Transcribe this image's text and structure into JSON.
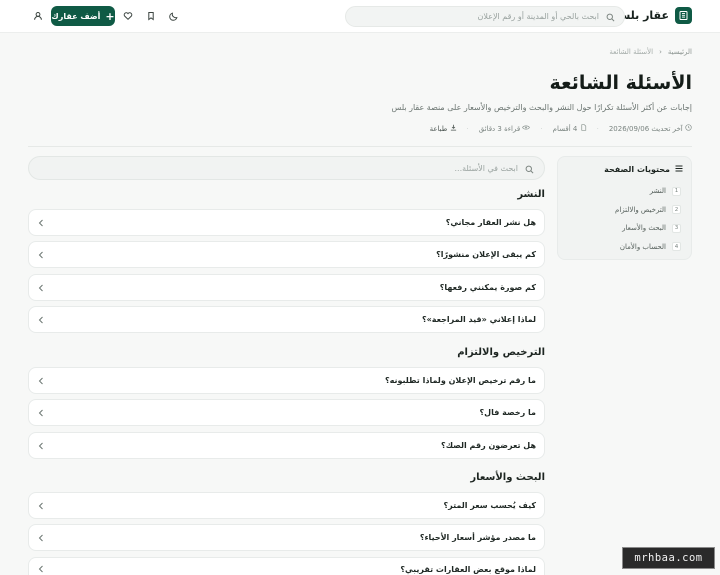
{
  "header": {
    "brand": "عقار بلس",
    "search_placeholder": "ابحث بالحي أو المدينة أو رقم الإعلان",
    "add_label": "أضف عقارك"
  },
  "breadcrumb": {
    "home": "الرئيسية",
    "sep": "‹",
    "current": "الأسئلة الشائعة"
  },
  "page": {
    "title": "الأسئلة الشائعة",
    "description": "إجابات عن أكثر الأسئلة تكرارًا حول النشر والبحث والترخيص والأسعار على منصة عقار بلس",
    "meta": {
      "updated": "آخر تحديث 2026/09/06",
      "sections": "4 أقسام",
      "reading": "قراءة 3 دقائق",
      "print": "طباعة"
    }
  },
  "toc": {
    "title": "محتويات الصفحة",
    "items": [
      {
        "num": "1",
        "label": "النشر"
      },
      {
        "num": "2",
        "label": "الترخيص والالتزام"
      },
      {
        "num": "3",
        "label": "البحث والأسعار"
      },
      {
        "num": "4",
        "label": "الحساب والأمان"
      }
    ]
  },
  "faq": {
    "search_placeholder": "ابحث في الأسئلة...",
    "sections": [
      {
        "title": "النشر",
        "questions": [
          "هل نشر العقار مجاني؟",
          "كم يبقى الإعلان منشورًا؟",
          "كم صورة يمكنني رفعها؟",
          "لماذا إعلاني «قيد المراجعة»؟"
        ]
      },
      {
        "title": "الترخيص والالتزام",
        "questions": [
          "ما رقم ترخيص الإعلان ولماذا تطلبونه؟",
          "ما رخصة فال؟",
          "هل تعرضون رقم الصك؟"
        ]
      },
      {
        "title": "البحث والأسعار",
        "questions": [
          "كيف يُحسب سعر المتر؟",
          "ما مصدر مؤشر أسعار الأحياء؟",
          "لماذا موقع بعض العقارات تقريبي؟"
        ]
      }
    ]
  },
  "watermark": "mrhbaa.com",
  "colors": {
    "brand": "#0f5a45",
    "background": "#f7f8f7"
  }
}
